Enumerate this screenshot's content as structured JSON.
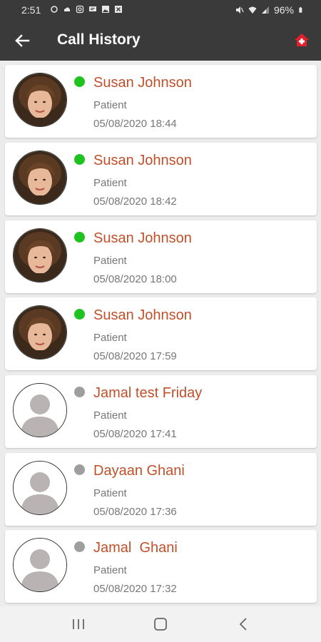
{
  "status_bar": {
    "time": "2:51",
    "battery": "96%",
    "icons": [
      "slack-icon",
      "cloud-icon",
      "instagram-icon",
      "message-icon",
      "image-icon",
      "close-box-icon",
      "mute-icon",
      "wifi-icon",
      "signal-icon",
      "battery-icon"
    ]
  },
  "app_bar": {
    "title": "Call History",
    "back_icon": "arrow-left-icon",
    "home_icon": "medical-home-icon",
    "accent": "#e0202a"
  },
  "calls": [
    {
      "name": "Susan Johnson",
      "role": "Patient",
      "datetime": "05/08/2020 18:44",
      "status": "online",
      "avatar": "photo"
    },
    {
      "name": "Susan Johnson",
      "role": "Patient",
      "datetime": "05/08/2020 18:42",
      "status": "online",
      "avatar": "photo"
    },
    {
      "name": "Susan Johnson",
      "role": "Patient",
      "datetime": "05/08/2020 18:00",
      "status": "online",
      "avatar": "photo"
    },
    {
      "name": "Susan Johnson",
      "role": "Patient",
      "datetime": "05/08/2020 17:59",
      "status": "online",
      "avatar": "photo"
    },
    {
      "name": "Jamal test Friday",
      "role": "Patient",
      "datetime": "05/08/2020 17:41",
      "status": "offline",
      "avatar": "placeholder"
    },
    {
      "name": "Dayaan Ghani",
      "role": "Patient",
      "datetime": "05/08/2020 17:36",
      "status": "offline",
      "avatar": "placeholder"
    },
    {
      "name": "Jamal  Ghani",
      "role": "Patient",
      "datetime": "05/08/2020 17:32",
      "status": "offline",
      "avatar": "placeholder"
    }
  ],
  "colors": {
    "online": "#1fc31f",
    "offline": "#9e9e9e",
    "name": "#c0502a",
    "bar": "#3a3a3a"
  },
  "nav_bar": {
    "icons": [
      "recent-apps-icon",
      "home-icon",
      "back-icon"
    ]
  }
}
